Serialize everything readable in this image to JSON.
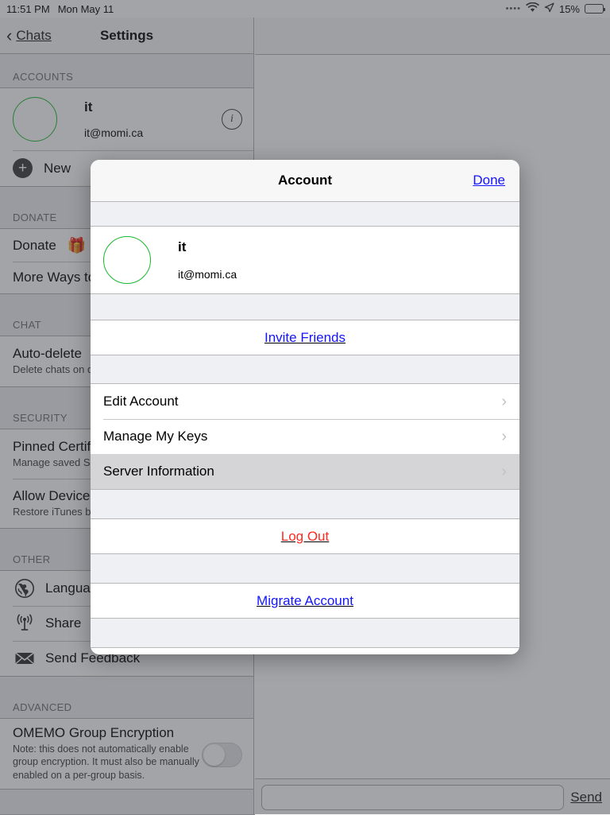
{
  "status_bar": {
    "time": "11:51 PM",
    "date": "Mon May 11",
    "signal_dots": "••••",
    "wifi_icon": "wifi-icon",
    "location_icon": "location-arrow-icon",
    "battery_percent": "15%",
    "battery_level": 15
  },
  "nav": {
    "back_label": "Chats",
    "title": "Settings"
  },
  "composer": {
    "placeholder": "",
    "value": "",
    "send_label": "Send"
  },
  "sidebar": {
    "sections": [
      {
        "header": "ACCOUNTS",
        "rows": [
          {
            "type": "account",
            "name": "it",
            "jid": "it@momi.ca",
            "info_icon": "info-circle-icon"
          },
          {
            "type": "action",
            "icon": "plus-circle-icon",
            "title": "New"
          }
        ]
      },
      {
        "header": "DONATE",
        "rows": [
          {
            "type": "plain",
            "title": "Donate",
            "emoji": "🎁"
          },
          {
            "type": "plain",
            "title": "More Ways to"
          }
        ]
      },
      {
        "header": "CHAT",
        "rows": [
          {
            "type": "detail",
            "title": "Auto-delete",
            "subtitle": "Delete chats on d"
          }
        ]
      },
      {
        "header": "SECURITY",
        "rows": [
          {
            "type": "detail",
            "title": "Pinned Certif",
            "subtitle": "Manage saved SS"
          },
          {
            "type": "detail",
            "title": "Allow Device",
            "subtitle": "Restore iTunes ba"
          }
        ]
      },
      {
        "header": "OTHER",
        "rows": [
          {
            "type": "icon",
            "icon": "globe-icon",
            "title": "Languag"
          },
          {
            "type": "icon",
            "icon": "broadcast-icon",
            "title": "Share"
          },
          {
            "type": "icon",
            "icon": "envelope-icon",
            "title": "Send Feedback"
          }
        ]
      },
      {
        "header": "ADVANCED",
        "rows": [
          {
            "type": "toggle",
            "title": "OMEMO Group Encryption",
            "note": "Note: this does not automatically enable group encryption. It must also be manually enabled on a per-group basis.",
            "toggle_on": false
          }
        ]
      }
    ]
  },
  "modal": {
    "title": "Account",
    "done_label": "Done",
    "account": {
      "name": "it",
      "jid": "it@momi.ca",
      "avatar_color": "#17b92e"
    },
    "invite_label": "Invite Friends",
    "menu": [
      {
        "label": "Edit Account",
        "chevron": "chevron-right-icon",
        "pressed": false
      },
      {
        "label": "Manage My Keys",
        "chevron": "chevron-right-icon",
        "pressed": false
      },
      {
        "label": "Server Information",
        "chevron": "chevron-right-icon",
        "pressed": true
      }
    ],
    "logout_label": "Log Out",
    "migrate_label": "Migrate Account"
  },
  "colors": {
    "link_blue": "#1414ff",
    "destructive_red": "#ff2a21",
    "avatar_green": "#17b92e",
    "pressed_row": "#d5d5d7",
    "group_bg": "#eff0f4"
  }
}
